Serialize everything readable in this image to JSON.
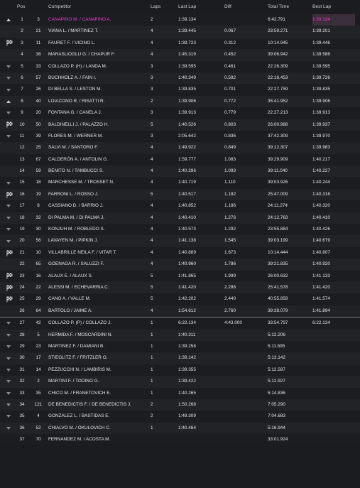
{
  "header": {
    "pos": "Pos",
    "competitor": "Competitor",
    "laps": "Laps",
    "last_lap": "Last Lap",
    "diff": "Diff",
    "total_time": "Total Time",
    "best_lap": "Best Lap"
  },
  "colors": {
    "highlight": "#e83fd1",
    "background": "#1b1c1f",
    "row_alt": "#222327"
  },
  "rows": [
    {
      "icon": "up",
      "pos": "1",
      "num": "3",
      "name": "CANAPINO M. / CANAPINO A.",
      "laps": "2",
      "last": "1:39.134",
      "diff": "",
      "total": "6:42.791",
      "best": "1:39.134",
      "highlight": true
    },
    {
      "icon": "",
      "pos": "2",
      "num": "21",
      "name": "VIANA L. / MARTINEZ T.",
      "laps": "4",
      "last": "1:39.445",
      "diff": "0.067",
      "total": "23:59.271",
      "best": "1:39.201"
    },
    {
      "icon": "flag",
      "pos": "3",
      "num": "11",
      "name": "FAURET F. / VICINO L.",
      "laps": "4",
      "last": "1:39.723",
      "diff": "0.312",
      "total": "10:14.945",
      "best": "1:39.446"
    },
    {
      "icon": "",
      "pos": "4",
      "num": "38",
      "name": "MARASLIOGLU G. / CHAPUR F.",
      "laps": "4",
      "last": "1:45.319",
      "diff": "0.452",
      "total": "39:06.942",
      "best": "1:39.586"
    },
    {
      "icon": "down",
      "pos": "5",
      "num": "33",
      "name": "COLLAZO P. (H) / LANDA M.",
      "laps": "3",
      "last": "1:39.595",
      "diff": "0.461",
      "total": "22:26.309",
      "best": "1:39.595"
    },
    {
      "icon": "down",
      "pos": "6",
      "num": "57",
      "name": "BUCHHOLZ A. / FAIN I.",
      "laps": "3",
      "last": "1:40.349",
      "diff": "0.592",
      "total": "22:16.453",
      "best": "1:39.726"
    },
    {
      "icon": "down",
      "pos": "7",
      "num": "26",
      "name": "DI BELLA S. / LESTON M.",
      "laps": "3",
      "last": "1:39.835",
      "diff": "0.701",
      "total": "22:27.759",
      "best": "1:39.835"
    },
    {
      "icon": "up",
      "pos": "8",
      "num": "40",
      "name": "LOIACONO R. / RISATTI R.",
      "laps": "2",
      "last": "1:39.906",
      "diff": "0.772",
      "total": "35:41.952",
      "best": "1:39.906"
    },
    {
      "icon": "down",
      "pos": "9",
      "num": "20",
      "name": "FONTANA G. / CANELA J.",
      "laps": "3",
      "last": "1:39.913",
      "diff": "0.779",
      "total": "22:27.213",
      "best": "1:39.913"
    },
    {
      "icon": "flag",
      "pos": "10",
      "num": "50",
      "name": "BALDINELLI J. / PALAZZO H.",
      "laps": "5",
      "last": "1:40.526",
      "diff": "0.803",
      "total": "26:00.988",
      "best": "1:39.937"
    },
    {
      "icon": "down",
      "pos": "11",
      "num": "39",
      "name": "FLORES M. / WERNER M.",
      "laps": "3",
      "last": "2:05.642",
      "diff": "0.836",
      "total": "37:42.309",
      "best": "1:39.970"
    },
    {
      "icon": "",
      "pos": "12",
      "num": "25",
      "name": "SALVI M. / SANTORO F.",
      "laps": "4",
      "last": "1:49.922",
      "diff": "0.849",
      "total": "39:12.307",
      "best": "1:39.983"
    },
    {
      "icon": "",
      "pos": "13",
      "num": "67",
      "name": "CALDERÓN A. / ANTOLIN G.",
      "laps": "4",
      "last": "1:59.777",
      "diff": "1.083",
      "total": "39:29.909",
      "best": "1:40.217"
    },
    {
      "icon": "",
      "pos": "14",
      "num": "59",
      "name": "BENITO N. / TAMBUCCI S.",
      "laps": "4",
      "last": "1:40.296",
      "diff": "1.093",
      "total": "39:11.040",
      "best": "1:40.227"
    },
    {
      "icon": "down",
      "pos": "15",
      "num": "18",
      "name": "MARCHESSE M. / TROSSET N.",
      "laps": "4",
      "last": "1:40.719",
      "diff": "1.110",
      "total": "39:03.926",
      "best": "1:40.244"
    },
    {
      "icon": "flag",
      "pos": "16",
      "num": "19",
      "name": "FARRONI L. / ROSSO J.",
      "laps": "5",
      "last": "1:40.517",
      "diff": "1.182",
      "total": "25:47.009",
      "best": "1:40.316"
    },
    {
      "icon": "down",
      "pos": "17",
      "num": "8",
      "name": "CASSIANO D. / BARRIO J.",
      "laps": "4",
      "last": "1:40.852",
      "diff": "1.186",
      "total": "24:11.274",
      "best": "1:40.320"
    },
    {
      "icon": "down",
      "pos": "18",
      "num": "32",
      "name": "DI PALMA M. / DI PALMA J.",
      "laps": "4",
      "last": "1:40.410",
      "diff": "1.276",
      "total": "24:12.763",
      "best": "1:40.410"
    },
    {
      "icon": "down",
      "pos": "19",
      "num": "30",
      "name": "KONJUH M. / ROBLEDO S.",
      "laps": "4",
      "last": "1:40.573",
      "diff": "1.292",
      "total": "23:55.884",
      "best": "1:40.426"
    },
    {
      "icon": "down",
      "pos": "20",
      "num": "56",
      "name": "LAVAYEN M. / PIPKIN J.",
      "laps": "4",
      "last": "1:41.138",
      "diff": "1.545",
      "total": "39:03.199",
      "best": "1:40.679"
    },
    {
      "icon": "flag",
      "pos": "21",
      "num": "10",
      "name": "VILLABRILLE NEILA F. / VITAR T",
      "laps": "4",
      "last": "1:40.889",
      "diff": "1.673",
      "total": "10:14.444",
      "best": "1:40.807"
    },
    {
      "icon": "",
      "pos": "22",
      "num": "65",
      "name": "GOENAGA R. / SALUZZI F.",
      "laps": "4",
      "last": "1:40.960",
      "diff": "1.786",
      "total": "39:21.835",
      "best": "1:40.920"
    },
    {
      "icon": "flag",
      "pos": "23",
      "num": "16",
      "name": "ALAUX E. / ALAUX S.",
      "laps": "5",
      "last": "1:41.865",
      "diff": "1.999",
      "total": "26:00.632",
      "best": "1:41.133"
    },
    {
      "icon": "flag",
      "pos": "24",
      "num": "22",
      "name": "ALESSI M. / ECHEVARRIA C.",
      "laps": "5",
      "last": "1:41.420",
      "diff": "2.286",
      "total": "25:41.578",
      "best": "1:41.420"
    },
    {
      "icon": "flag",
      "pos": "25",
      "num": "29",
      "name": "CANO A. / VALLE M.",
      "laps": "5",
      "last": "1:42.202",
      "diff": "2.440",
      "total": "40:55.859",
      "best": "1:41.574"
    },
    {
      "icon": "",
      "pos": "26",
      "num": "64",
      "name": "BARTOLO / JAIME A.",
      "laps": "4",
      "last": "1:54.612",
      "diff": "2.760",
      "total": "39:38.079",
      "best": "1:41.894"
    },
    {
      "icon": "down",
      "pos": "27",
      "num": "42",
      "name": "COLLAZO P. (P) / COLLAZO J.",
      "laps": "1",
      "last": "6:22.134",
      "diff": "4:43.000",
      "total": "33:54.797",
      "best": "6:22.134",
      "sep": true
    },
    {
      "icon": "down",
      "pos": "28",
      "num": "5",
      "name": "HERMIDA F. / MOSCARDINI N.",
      "laps": "1",
      "last": "1:40.311",
      "diff": "",
      "total": "5:12.206",
      "best": ""
    },
    {
      "icon": "down",
      "pos": "29",
      "num": "23",
      "name": "MARTINEZ F. / DAMIANI B.",
      "laps": "1",
      "last": "1:39.258",
      "diff": "",
      "total": "5:11.595",
      "best": ""
    },
    {
      "icon": "down",
      "pos": "30",
      "num": "17",
      "name": "STIEGLITZ F. / FRITZLER O.",
      "laps": "1",
      "last": "1:39.142",
      "diff": "",
      "total": "5:13.142",
      "best": ""
    },
    {
      "icon": "down",
      "pos": "31",
      "num": "14",
      "name": "PEZZUCCHI N. / LAMBIRIS M.",
      "laps": "1",
      "last": "1:39.355",
      "diff": "",
      "total": "5:12.587",
      "best": ""
    },
    {
      "icon": "down",
      "pos": "32",
      "num": "2",
      "name": "MARTINI F. / TODINO G.",
      "laps": "1",
      "last": "1:39.422",
      "diff": "",
      "total": "5:12.927",
      "best": ""
    },
    {
      "icon": "down",
      "pos": "33",
      "num": "35",
      "name": "CHICO M. / FRANETOVICH E.",
      "laps": "1",
      "last": "1:40.265",
      "diff": "",
      "total": "5:14.836",
      "best": ""
    },
    {
      "icon": "down",
      "pos": "34",
      "num": "121",
      "name": "DE BENEDICTIS F. / DE BENEDICTIS J.",
      "laps": "2",
      "last": "1:50.268",
      "diff": "",
      "total": "7:05.290",
      "best": ""
    },
    {
      "icon": "down",
      "pos": "35",
      "num": "4",
      "name": "GONZALEZ L. / BASTIDAS E.",
      "laps": "2",
      "last": "1:49.309",
      "diff": "",
      "total": "7:04.683",
      "best": ""
    },
    {
      "icon": "down",
      "pos": "36",
      "num": "52",
      "name": "CHIALVO M. / OKULOVICH C.",
      "laps": "1",
      "last": "1:40.464",
      "diff": "",
      "total": "5:16.944",
      "best": ""
    },
    {
      "icon": "",
      "pos": "37",
      "num": "70",
      "name": "FERNANDEZ M. / ACOSTA M.",
      "laps": "",
      "last": "",
      "diff": "",
      "total": "33:01.924",
      "best": ""
    }
  ]
}
